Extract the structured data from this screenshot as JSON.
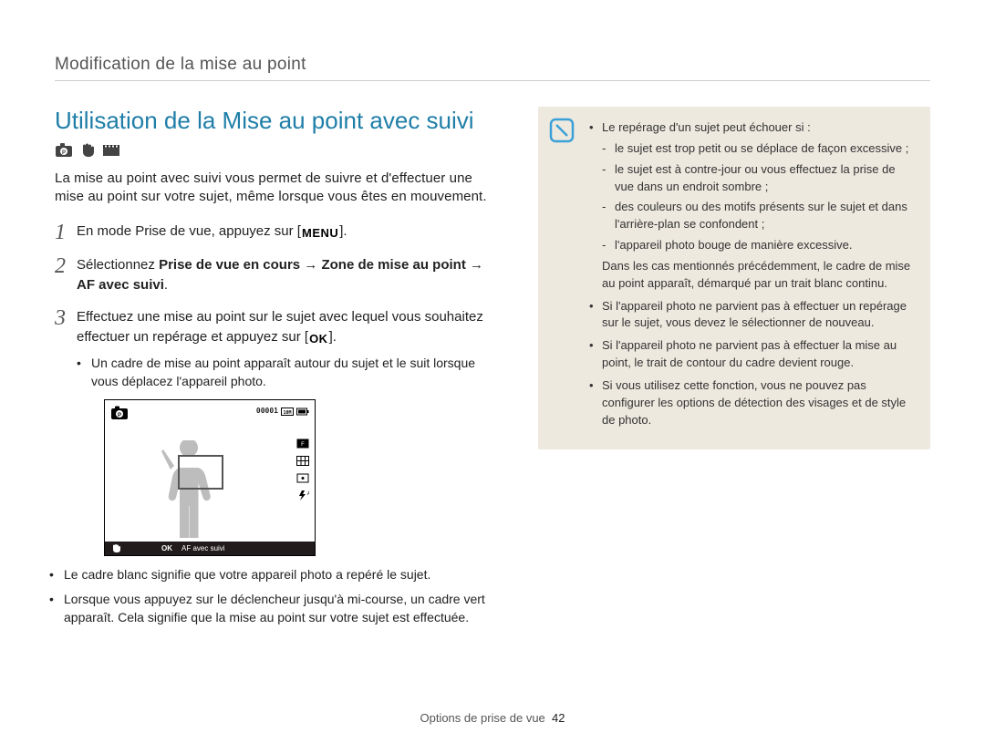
{
  "header": {
    "breadcrumb": "Modification de la mise au point"
  },
  "title": "Utilisation de la Mise au point avec suivi",
  "intro": "La mise au point avec suivi vous permet de suivre et d'effectuer une mise au point sur votre sujet, même lorsque vous êtes en mouvement.",
  "btn": {
    "menu": "MENU",
    "ok": "OK"
  },
  "steps": {
    "s1": {
      "num": "1",
      "a": "En mode Prise de vue, appuyez sur [",
      "b": "]."
    },
    "s2": {
      "num": "2",
      "a": "Sélectionnez ",
      "bold": "Prise de vue en cours → Zone de mise au point → AF avec suivi",
      "b": "."
    },
    "s3": {
      "num": "3",
      "a": "Effectuez une mise au point sur le sujet avec lequel vous souhaitez effectuer un repérage et appuyez sur [",
      "b": "].",
      "sub1": "Un cadre de mise au point apparaît autour du sujet et le suit lorsque vous déplacez l'appareil photo."
    }
  },
  "preview": {
    "counter": "00001",
    "barLabel": "AF avec suivi",
    "barOk": "OK"
  },
  "postBullets": {
    "p1": "Le cadre blanc signifie que votre appareil photo a repéré le sujet.",
    "p2": "Lorsque vous appuyez sur le déclencheur jusqu'à mi-course, un cadre vert apparaît. Cela signifie que la mise au point sur votre sujet est effectuée."
  },
  "note": {
    "u1": "Le repérage d'un sujet peut échouer si :",
    "u1s1": "le sujet est trop petit ou se déplace de façon excessive ;",
    "u1s2": "le sujet est à contre-jour ou vous effectuez la prise de vue dans un endroit sombre ;",
    "u1s3": "des couleurs ou des motifs présents sur le sujet et dans l'arrière-plan se confondent ;",
    "u1s4": "l'appareil photo bouge de manière excessive.",
    "u1after": "Dans les cas mentionnés précédemment, le cadre de mise au point apparaît, démarqué par un trait blanc continu.",
    "u2": "Si l'appareil photo ne parvient pas à effectuer un repérage sur le sujet, vous devez le sélectionner de nouveau.",
    "u3": "Si l'appareil photo ne parvient pas à effectuer la mise au point, le trait de contour du cadre devient rouge.",
    "u4": "Si vous utilisez cette fonction, vous ne pouvez pas configurer les options de détection des visages et de style de photo."
  },
  "footer": {
    "section": "Options de prise de vue",
    "page": "42"
  }
}
